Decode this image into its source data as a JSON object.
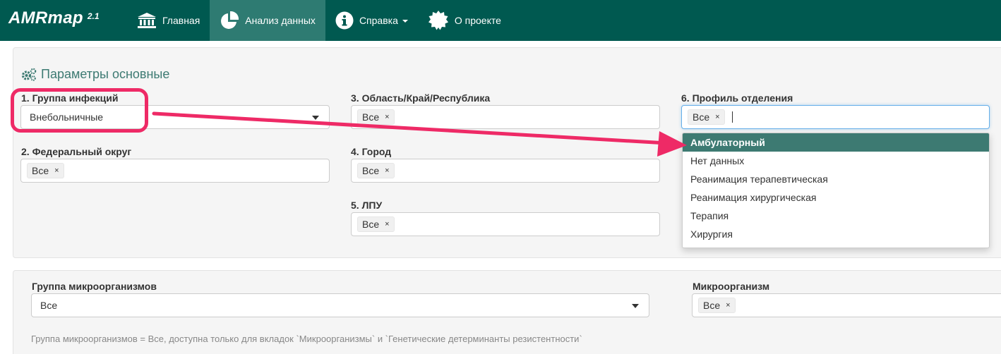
{
  "brand": {
    "name": "AMRmap",
    "version": "2.1"
  },
  "nav": {
    "items": [
      {
        "label": "Главная",
        "icon": "bank-icon"
      },
      {
        "label": "Анализ данных",
        "icon": "pie-chart-icon",
        "active": true
      },
      {
        "label": "Справка",
        "icon": "info-circle-icon",
        "dropdown": true
      },
      {
        "label": "О проекте",
        "icon": "badge-icon"
      }
    ]
  },
  "params": {
    "title": "Параметры основные",
    "infection_group": {
      "label": "1. Группа инфекций",
      "value": "Внебольничные"
    },
    "federal_district": {
      "label": "2. Федеральный округ",
      "chip": "Все"
    },
    "region": {
      "label": "3. Область/Край/Республика",
      "chip": "Все"
    },
    "city": {
      "label": "4. Город",
      "chip": "Все"
    },
    "lpu": {
      "label": "5. ЛПУ",
      "chip": "Все"
    },
    "department_profile": {
      "label": "6. Профиль отделения",
      "chip": "Все",
      "options": [
        "Амбулаторный",
        "Нет данных",
        "Реанимация терапевтическая",
        "Реанимация хирургическая",
        "Терапия",
        "Хирургия"
      ],
      "highlighted_index": 0
    }
  },
  "micro": {
    "group": {
      "label": "Группа микроорганизмов",
      "value": "Все"
    },
    "organism": {
      "label": "Микроорганизм",
      "chip": "Все"
    },
    "note": "Группа микроорганизмов = Все, доступна только для вкладок `Микроорганизмы` и `Генетические детерминанты резистентности`"
  },
  "colors": {
    "navbar": "#005950",
    "nav_active": "#2e7b72",
    "accent": "#3d7a72",
    "annotation": "#ee2a66"
  }
}
